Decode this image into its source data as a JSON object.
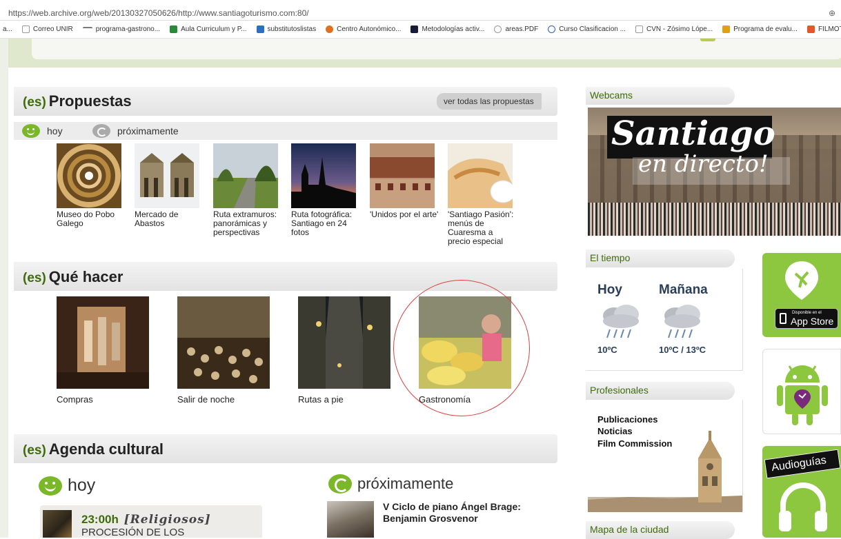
{
  "browser": {
    "url": "https://web.archive.org/web/20130327050626/http://www.santiagoturismo.com:80/",
    "zoom_icon": "⊕",
    "bookmarks": [
      {
        "label": "a...",
        "icon": "none"
      },
      {
        "label": "Correo UNIR",
        "icon": "page-icon"
      },
      {
        "label": "programa-gastrono...",
        "icon": "unir-icon"
      },
      {
        "label": "Aula Curriculum y P...",
        "icon": "aula-icon"
      },
      {
        "label": "substitutoslistas",
        "icon": "sheet-icon"
      },
      {
        "label": "Centro Autonómico...",
        "icon": "centro-icon"
      },
      {
        "label": "Metodologías activ...",
        "icon": "metod-icon"
      },
      {
        "label": "areas.PDF",
        "icon": "pdf-icon"
      },
      {
        "label": "Curso Clasificacion ...",
        "icon": "curso-icon"
      },
      {
        "label": "CVN - Zósimo Lópe...",
        "icon": "page-icon"
      },
      {
        "label": "Programa de evalu...",
        "icon": "prog-icon"
      },
      {
        "label": "FILMOTECA JACOB...",
        "icon": "film-icon"
      }
    ]
  },
  "propuestas": {
    "lang": "(es)",
    "title": "Propuestas",
    "see_all": "ver todas las propuestas",
    "tab_today": "hoy",
    "tab_soon": "próximamente",
    "items": [
      {
        "caption": "Museo do Pobo Galego"
      },
      {
        "caption": "Mercado de Abastos"
      },
      {
        "caption": "Ruta extramuros: panorámicas y perspectivas"
      },
      {
        "caption": "Ruta fotográfica: Santiago en 24 fotos"
      },
      {
        "caption": "'Unidos por el arte'"
      },
      {
        "caption": "'Santiago Pasión': menús de Cuaresma a precio especial"
      }
    ]
  },
  "que_hacer": {
    "lang": "(es)",
    "title": "Qué hacer",
    "items": [
      {
        "caption": "Compras"
      },
      {
        "caption": "Salir de noche"
      },
      {
        "caption": "Rutas a pie"
      },
      {
        "caption": "Gastronomía"
      }
    ]
  },
  "agenda": {
    "lang": "(es)",
    "title": "Agenda cultural",
    "today_label": "hoy",
    "soon_label": "próximamente",
    "event_today": {
      "time": "23:00h",
      "category": "[Religiosos]",
      "name": "PROCESIÓN DE LOS"
    },
    "event_soon": {
      "title": "V Ciclo de piano Ángel Brage: Benjamin Grosvenor"
    }
  },
  "sidebar": {
    "webcams": "Webcams",
    "webcam_text1": "Santiago",
    "webcam_text2": "en directo!",
    "weather_title": "El tiempo",
    "today": "Hoy",
    "tomorrow": "Mañana",
    "today_temp": "10ºC",
    "tomorrow_temp": "10ºC / 13ºC",
    "profesionales": "Profesionales",
    "links": [
      "Publicaciones",
      "Noticias",
      "Film Commission"
    ],
    "mapa": "Mapa de la ciudad",
    "appstore_small": "Disponible en el",
    "appstore": "App Store",
    "audioguias": "Audioguías"
  },
  "colors": {
    "accent": "#3e6b0a",
    "green": "#8dc63f",
    "highlight_circle": "#d94040"
  }
}
